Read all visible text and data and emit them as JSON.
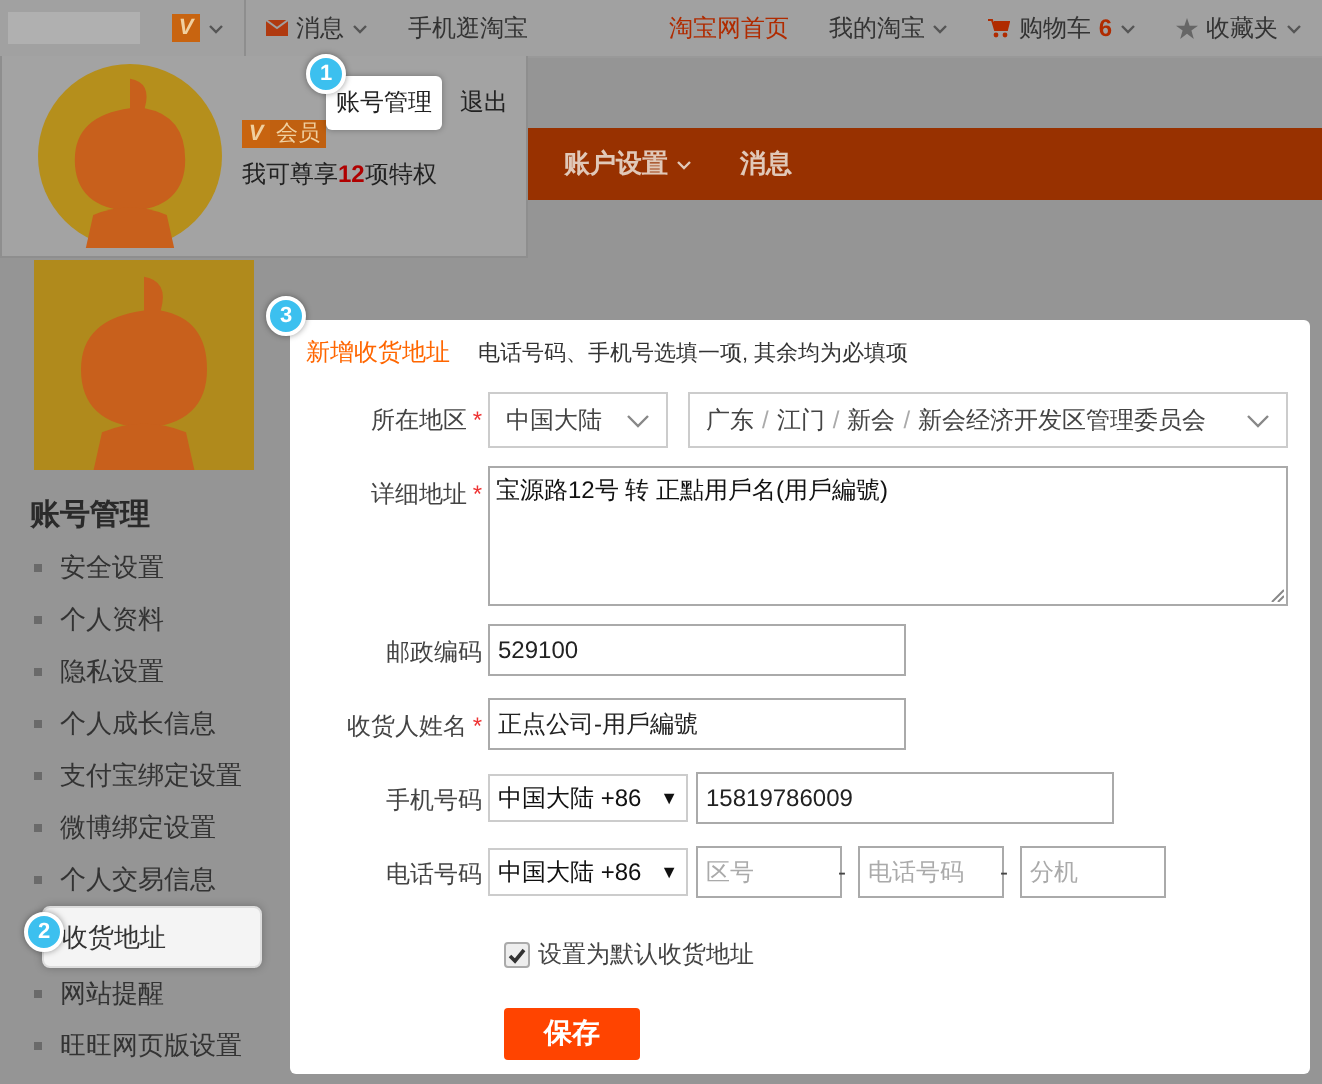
{
  "top_bar": {
    "left": [
      {
        "kind": "member-badge",
        "label": "V"
      },
      {
        "kind": "mail-menu",
        "label": "消息"
      },
      {
        "kind": "link",
        "label": "手机逛淘宝"
      }
    ],
    "right": [
      {
        "kind": "home",
        "label": "淘宝网首页"
      },
      {
        "kind": "menu",
        "label": "我的淘宝"
      },
      {
        "kind": "cart",
        "label": "购物车",
        "count": "6"
      },
      {
        "kind": "favorites",
        "label": "收藏夹"
      }
    ]
  },
  "account_dropdown": {
    "badge": "V",
    "badge_label": "会员",
    "privilege_text": "我可尊享**12**项特权",
    "buttons": [
      {
        "label": "账号管理",
        "selected": true
      },
      {
        "label": "退出",
        "selected": false
      }
    ]
  },
  "nav": [
    {
      "label": "账户设置",
      "dropdown": true
    },
    {
      "label": "消息",
      "dropdown": false
    }
  ],
  "sidebar": {
    "title": "账号管理",
    "items": [
      {
        "label": "安全设置",
        "selected": false
      },
      {
        "label": "个人资料",
        "selected": false
      },
      {
        "label": "隐私设置",
        "selected": false
      },
      {
        "label": "个人成长信息",
        "selected": false
      },
      {
        "label": "支付宝绑定设置",
        "selected": false
      },
      {
        "label": "微博绑定设置",
        "selected": false
      },
      {
        "label": "个人交易信息",
        "selected": false
      },
      {
        "label": "收货地址",
        "selected": true
      },
      {
        "label": "网站提醒",
        "selected": false
      },
      {
        "label": "旺旺网页版设置",
        "selected": false
      }
    ]
  },
  "form": {
    "title": "新增收货地址",
    "hint": "电话号码、手机号选填一项, 其余均为必填项",
    "required_mark": "*",
    "separator": "/",
    "dash": "-",
    "dropdown_mark": "▼",
    "rows": [
      {
        "kind": "region",
        "label": "所在地区",
        "required": true,
        "country": "中国大陆",
        "region_parts": [
          "广东",
          "江门",
          "新会",
          "新会经济开发区管理委员会"
        ]
      },
      {
        "kind": "textarea",
        "label": "详细地址",
        "required": true,
        "value": "宝源路12号 转 正點用戶名(用戶編號)"
      },
      {
        "kind": "input",
        "label": "邮政编码",
        "required": false,
        "value": "529100"
      },
      {
        "kind": "input",
        "label": "收货人姓名",
        "required": true,
        "value": "正点公司-用戶編號"
      },
      {
        "kind": "mobile",
        "label": "手机号码",
        "required": false,
        "country": "中国大陆 +86",
        "value": "15819786009"
      },
      {
        "kind": "phone",
        "label": "电话号码",
        "required": false,
        "country": "中国大陆 +86",
        "placeholders": [
          "区号",
          "电话号码",
          "分机"
        ]
      }
    ],
    "default_checkbox": {
      "label": "设置为默认收货地址",
      "checked": true
    },
    "save_button": "保存"
  },
  "callouts": [
    {
      "number": "1"
    },
    {
      "number": "2"
    },
    {
      "number": "3"
    }
  ]
}
